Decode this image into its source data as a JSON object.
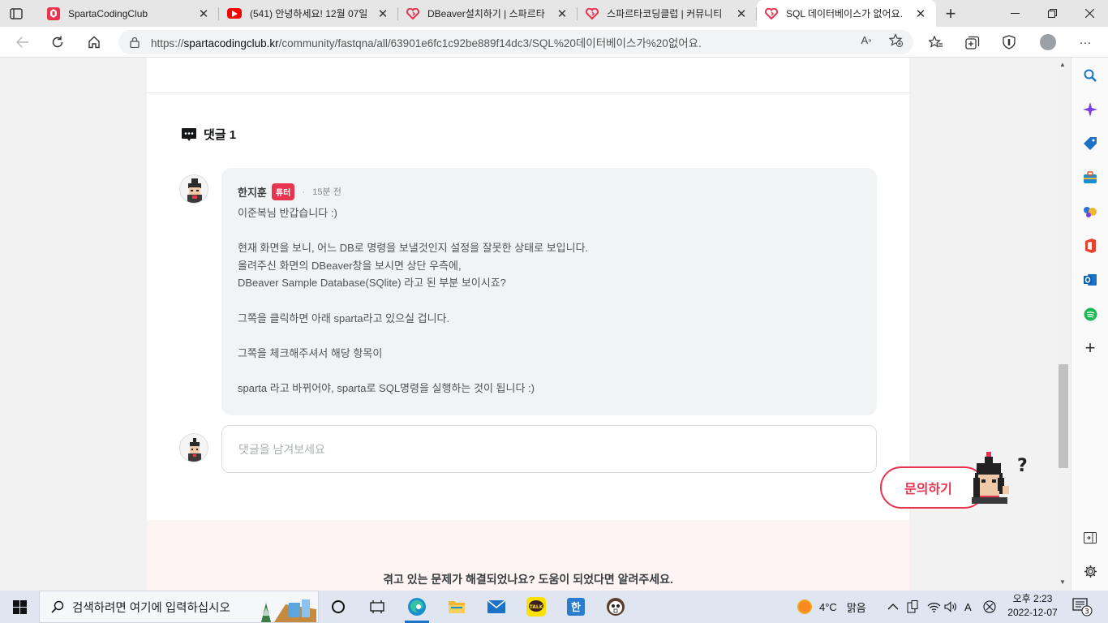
{
  "browser": {
    "tabs": [
      {
        "title": "SpartaCodingClub",
        "favicon": "sparta-logo-icon",
        "active": false
      },
      {
        "title": "(541) 안녕하세요! 12월 07일",
        "favicon": "youtube-icon",
        "active": false
      },
      {
        "title": "DBeaver설치하기 | 스파르타",
        "favicon": "sparta-heart-icon",
        "active": false
      },
      {
        "title": "스파르타코딩클럽 | 커뮤니티",
        "favicon": "sparta-heart-icon",
        "active": false
      },
      {
        "title": "SQL 데이터베이스가 없어요.",
        "favicon": "sparta-heart-icon",
        "active": true
      }
    ],
    "url_prefix": "https://",
    "url_host": "spartacodingclub.kr",
    "url_path": "/community/fastqna/all/63901e6fc1c92be889f14dc3/SQL%20데이터베이스가%20없어요."
  },
  "comments": {
    "title": "댓글 1",
    "items": [
      {
        "author": "한지훈",
        "badge": "튜터",
        "separator": "·",
        "time": "15분 전",
        "lines": [
          "이준복님 반갑습니다 :)",
          "",
          "현재 화면을 보니, 어느 DB로 명령을 보낼것인지 설정을 잘못한 상태로 보입니다.",
          "올려주신 화면의 DBeaver창을 보시면 상단 우측에,",
          "DBeaver Sample Database(SQlite) 라고 된 부분 보이시죠?",
          "",
          "그쪽을 클릭하면 아래 sparta라고 있으실 겁니다.",
          "",
          "그쪽을 체크해주셔서 해당 항목이",
          "",
          "sparta 라고 바뀌어야, sparta로 SQL명령을 실행하는 것이 됩니다 :)"
        ]
      }
    ],
    "input_placeholder": "댓글을 남겨보세요"
  },
  "feedback": {
    "prompt": "겪고 있는 문제가 해결되었나요? 도움이 되었다면 알려주세요."
  },
  "ask_button": {
    "label": "문의하기",
    "mascot_mark": "?"
  },
  "taskbar": {
    "search_placeholder": "검색하려면 여기에 입력하십시오",
    "weather_temp": "4°C",
    "weather_desc": "맑음",
    "ime": "A",
    "time": "오후 2:23",
    "date": "2022-12-07",
    "notification_count": "3",
    "kakao_label": "TALK",
    "hangul_label": "한"
  },
  "colors": {
    "accent": "#e8344e",
    "edge_blue": "#1a73c8"
  }
}
